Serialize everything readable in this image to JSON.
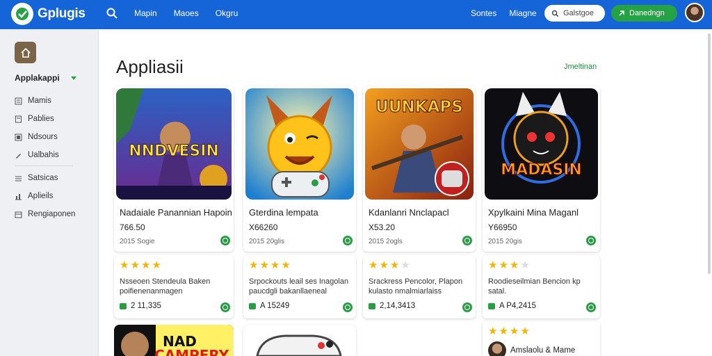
{
  "topbar": {
    "brand": "Gplugis",
    "nav": [
      "Mapin",
      "Maoes",
      "Okgru"
    ],
    "right_links": [
      "Sontes",
      "Miagne"
    ],
    "search_pill": "Galstgoe",
    "action_button": "Danedngn",
    "accent": "#1565d8",
    "green": "#25a244"
  },
  "sidebar": {
    "section": "Applakappi",
    "items": [
      {
        "label": "Mamis",
        "icon": "list-icon"
      },
      {
        "label": "Pablies",
        "icon": "page-icon"
      },
      {
        "label": "Ndsours",
        "icon": "file-icon"
      },
      {
        "label": "Ualbahis",
        "icon": "pen-icon"
      },
      {
        "label": "Satsicas",
        "icon": "list-icon"
      },
      {
        "label": "Aplieils",
        "icon": "chart-icon"
      },
      {
        "label": "Rengiaponen",
        "icon": "box-icon"
      }
    ]
  },
  "main": {
    "title": "Appliasii",
    "top_link": "Jmeltinan",
    "apps": [
      {
        "art_text": "NNDVESIN",
        "title": "Nadaiale Panannian Hapoin",
        "price": "766.50",
        "meta": "2015 Sogie"
      },
      {
        "art_text": "",
        "title": "Gterdina lempata",
        "price": "X66260",
        "meta": "2015 20glis"
      },
      {
        "art_text": "UUNKAPS",
        "title": "Kdanlanri Nnclapacl",
        "price": "X53.20",
        "meta": "2015 2ogls"
      },
      {
        "art_text": "MADASIN",
        "title": "Xpylkaini Mina Maganl",
        "price": "Y66950",
        "meta": "2015 20gis"
      }
    ],
    "reviews": [
      {
        "stars": 4,
        "desc": "Nsseoen Stendeula Baken poifienenanmagen",
        "count": "2 11,335"
      },
      {
        "stars": 4,
        "desc": "Srpockouts leail ses Inagolan paucdgli bakanllaeneal",
        "count": "A 15249"
      },
      {
        "stars": 3,
        "desc": "Srackress Pencolor, Plapon kulasto nmalmiarlaiss",
        "count": "2,14,3413"
      },
      {
        "stars": 3,
        "desc": "Roodieseilmian Bencion kp satal.",
        "count": "A P4,2415"
      }
    ],
    "bottom": {
      "art_text_1": "NAD",
      "art_text_2": "CAMPERY",
      "card4_stars": 4,
      "card4_text": "Amslaolu & Mame"
    }
  }
}
